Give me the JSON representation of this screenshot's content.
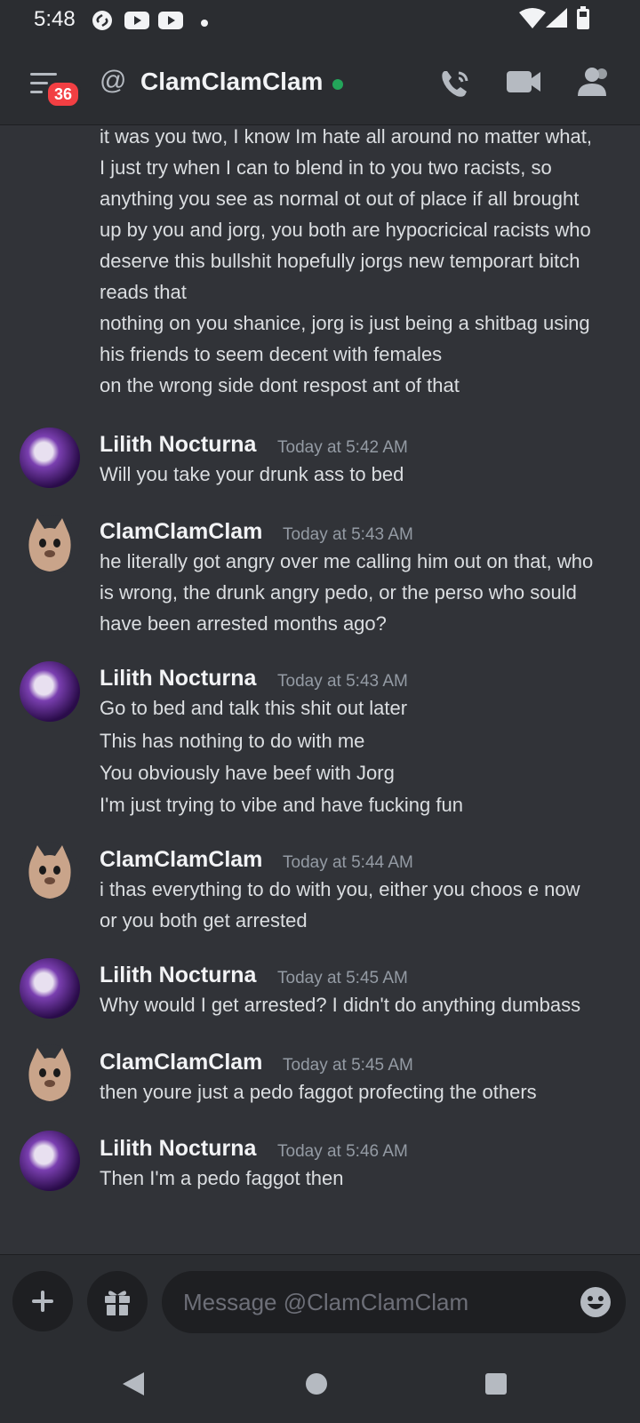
{
  "statusbar": {
    "time": "5:48"
  },
  "header": {
    "channel_name": "ClamClamClam",
    "unread_badge": "36",
    "online_color": "#23a55a"
  },
  "messages": [
    {
      "continuation": true,
      "lines": [
        "it was you two, I know Im hate all around no matter what,",
        "I just try when I can to blend in to you two racists,  so",
        "anything you see as normal ot out of place if all brought",
        "up by you and jorg, you both are hypocricical racists who",
        "deserve this bullshit hopefully jorgs new temporart bitch",
        "reads that",
        "nothing on you shanice, jorg is just being a shitbag using",
        "his friends to seem decent with females",
        "on the wrong side dont respost ant of that"
      ]
    },
    {
      "author": "Lilith Nocturna",
      "time": "Today at 5:42 AM",
      "avatar": "lilith",
      "lines": [
        "Will you take your drunk ass to bed"
      ]
    },
    {
      "author": "ClamClamClam",
      "time": "Today at 5:43 AM",
      "avatar": "clam",
      "lines": [
        "he literally got angry over me calling him out on that, who",
        "is wrong, the drunk angry pedo, or the perso who sould",
        "have been arrested months ago?"
      ]
    },
    {
      "author": "Lilith Nocturna",
      "time": "Today at 5:43 AM",
      "avatar": "lilith",
      "lines": [
        "Go to bed and talk this shit out later",
        "This has nothing to do with me",
        "You obviously have beef with Jorg",
        "I'm just trying to vibe and have fucking fun"
      ]
    },
    {
      "author": "ClamClamClam",
      "time": "Today at 5:44 AM",
      "avatar": "clam",
      "lines": [
        "i thas everything to do with you, either you choos e now",
        "or you both get arrested"
      ]
    },
    {
      "author": "Lilith Nocturna",
      "time": "Today at 5:45 AM",
      "avatar": "lilith",
      "lines": [
        "Why would I get arrested? I didn't do anything dumbass"
      ]
    },
    {
      "author": "ClamClamClam",
      "time": "Today at 5:45 AM",
      "avatar": "clam",
      "lines": [
        "then youre just a pedo faggot profecting the others"
      ]
    },
    {
      "author": "Lilith Nocturna",
      "time": "Today at 5:46 AM",
      "avatar": "lilith",
      "lines": [
        "Then I'm a pedo faggot then"
      ]
    }
  ],
  "composer": {
    "placeholder": "Message @ClamClamClam"
  }
}
